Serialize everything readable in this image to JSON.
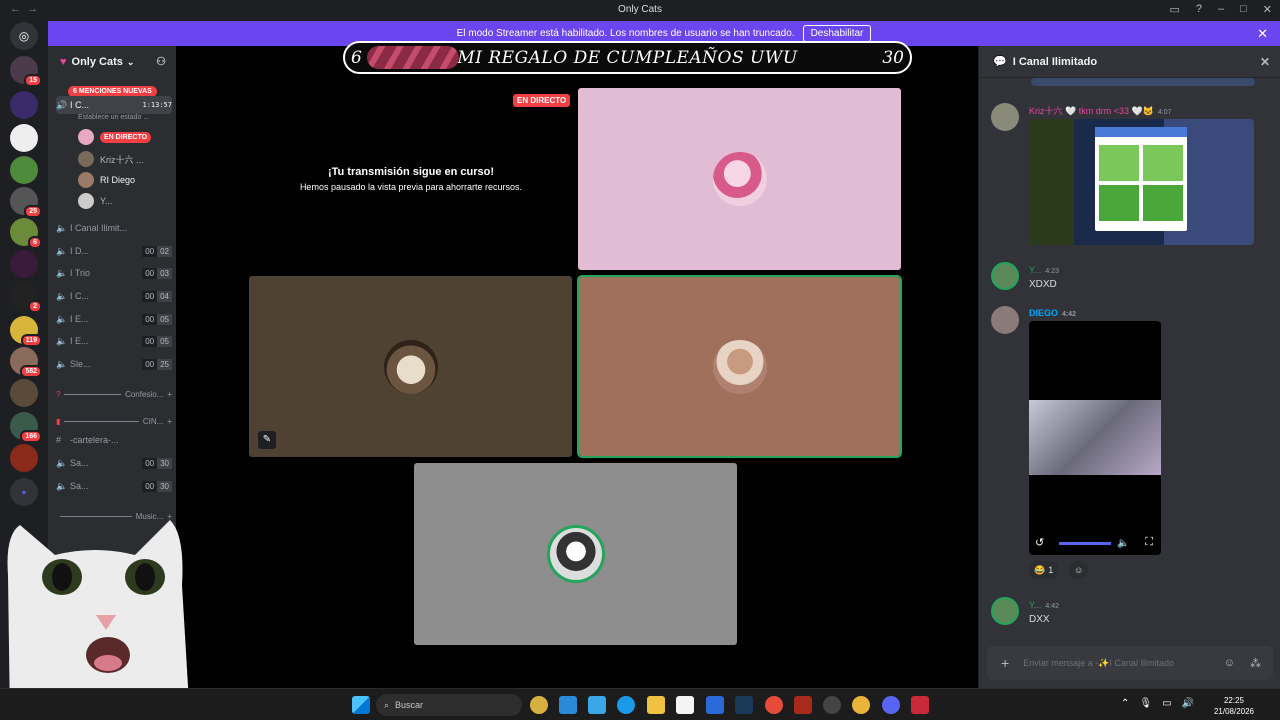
{
  "window": {
    "title": "Only Cats"
  },
  "banner": {
    "text": "El modo Streamer está habilitado. Los nombres de usuario se han truncado.",
    "button": "Deshabilitar"
  },
  "rail": {
    "badges": [
      "15",
      "25",
      "6",
      "2",
      "119",
      "582",
      "166"
    ]
  },
  "sidebar": {
    "guild_name": "Only Cats",
    "mentions": "6 MENCIONES NUEVAS",
    "active_channel": {
      "name": "I C...",
      "timer": "1:13:57",
      "status": "Establece un estado ..."
    },
    "users": [
      {
        "name": "EN DIRECTO",
        "live": true
      },
      {
        "name": "Kriz十六 ..."
      },
      {
        "name": "RI Diego"
      },
      {
        "name": "Y..."
      }
    ],
    "channels": [
      {
        "name": "I Canal Ilimit..."
      },
      {
        "name": "I D...",
        "a": "00",
        "b": "02"
      },
      {
        "name": "I Trio",
        "a": "00",
        "b": "03"
      },
      {
        "name": "I C...",
        "a": "00",
        "b": "04"
      },
      {
        "name": "I E...",
        "a": "00",
        "b": "05"
      },
      {
        "name": "I E...",
        "a": "00",
        "b": "05"
      },
      {
        "name": "Sle...",
        "a": "00",
        "b": "25"
      }
    ],
    "categories": [
      "Confesio...",
      "CIN...",
      "-cartelera-...",
      "Music..."
    ],
    "channels2": [
      {
        "name": "Sa...",
        "a": "00",
        "b": "30"
      },
      {
        "name": "Sa...",
        "a": "00",
        "b": "30"
      }
    ]
  },
  "stage": {
    "stream_title": "MI REGALO DE CUMPLEAÑOS UWU",
    "left_num": "6",
    "right_num": "30",
    "live_tag": "EN DIRECTO",
    "paused_heading": "¡Tu transmisión sigue en curso!",
    "paused_sub": "Hemos pausado la vista previa para ahorrarte recursos."
  },
  "chat": {
    "channel": "I Canal Ilimitado",
    "messages": [
      {
        "name": "Kriz十六 🤍 tkm drm <33 🤍🐱",
        "time": "4:07",
        "text": ""
      },
      {
        "name": "Y...",
        "time": "4:23",
        "text": "XDXD"
      },
      {
        "name": "DIEGO",
        "time": "4:42",
        "text": ""
      },
      {
        "name": "Y...",
        "time": "4:42",
        "text": "DXX"
      }
    ],
    "reaction_count": "1",
    "composer_placeholder": "Enviar mensaje a -✨I Canal Ilimitado"
  },
  "taskbar": {
    "search": "Buscar",
    "time": "22:25",
    "date": "21/08/2026"
  },
  "colors": {
    "accent": "#6b46f0",
    "live": "#f23f43",
    "speaking": "#23a55a"
  }
}
